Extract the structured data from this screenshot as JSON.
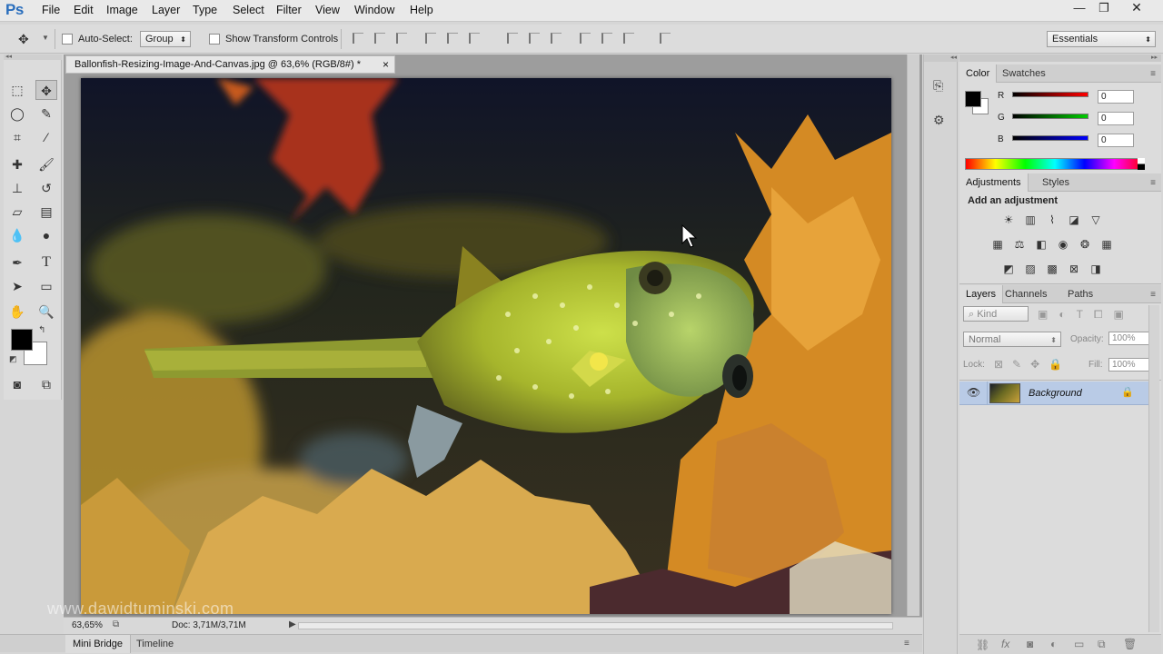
{
  "app": {
    "logo": "Ps"
  },
  "menu": [
    "File",
    "Edit",
    "Image",
    "Layer",
    "Type",
    "Select",
    "Filter",
    "View",
    "Window",
    "Help"
  ],
  "window_controls": {
    "minimize": "—",
    "restore": "❐",
    "close": "✕"
  },
  "options": {
    "auto_select_label": "Auto-Select:",
    "auto_select_value": "Group",
    "show_transform_label": "Show Transform Controls",
    "workspace": "Essentials"
  },
  "document": {
    "tab_title": "Ballonfish-Resizing-Image-And-Canvas.jpg @ 63,6% (RGB/8#) *",
    "close": "×"
  },
  "status": {
    "zoom": "63,65%",
    "doc": "Doc: 3,71M/3,71M"
  },
  "watermark": "www.dawidtuminski.com",
  "bottom_tabs": [
    "Mini Bridge",
    "Timeline"
  ],
  "color_panel": {
    "tabs": [
      "Color",
      "Swatches"
    ],
    "channels": [
      {
        "label": "R",
        "value": "0"
      },
      {
        "label": "G",
        "value": "0"
      },
      {
        "label": "B",
        "value": "0"
      }
    ],
    "foreground": "#000000",
    "background": "#ffffff"
  },
  "adjustments_panel": {
    "tabs": [
      "Adjustments",
      "Styles"
    ],
    "title": "Add an adjustment"
  },
  "layers_panel": {
    "tabs": [
      "Layers",
      "Channels",
      "Paths"
    ],
    "filter": "Kind",
    "blend_mode": "Normal",
    "opacity_label": "Opacity:",
    "opacity": "100%",
    "lock_label": "Lock:",
    "fill_label": "Fill:",
    "fill": "100%",
    "layers": [
      {
        "name": "Background",
        "visible": true,
        "locked": true
      }
    ]
  },
  "colors": {
    "accent": "#2a6ebd",
    "selected_layer": "#b9cbe6"
  }
}
